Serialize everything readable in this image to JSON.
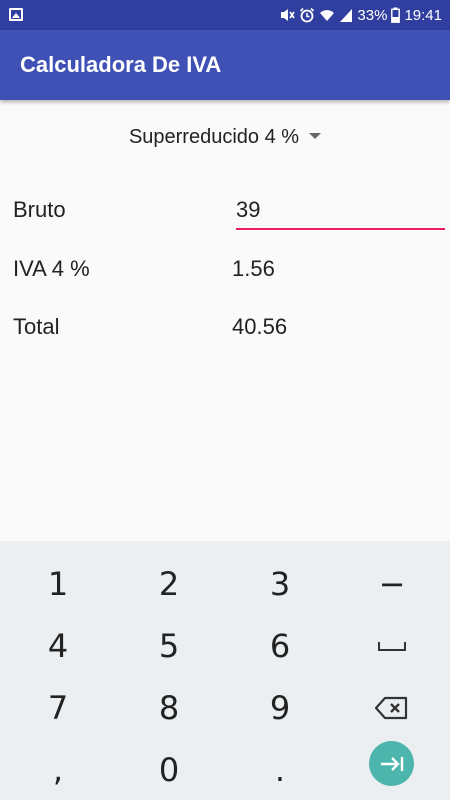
{
  "status_bar": {
    "battery_percent": "33%",
    "time": "19:41",
    "icons": [
      "gallery-icon",
      "mute-icon",
      "alarm-icon",
      "wifi-icon",
      "signal-icon",
      "battery-icon"
    ]
  },
  "app_bar": {
    "title": "Calculadora De IVA",
    "color": "#3f51b5",
    "status_color": "#303f9f"
  },
  "form": {
    "rate_selected": "Superreducido 4 %",
    "bruto_label": "Bruto",
    "bruto_value": "39",
    "iva_label": "IVA 4 %",
    "iva_value": "1.56",
    "total_label": "Total",
    "total_value": "40.56",
    "accent": "#e91e63"
  },
  "keyboard": {
    "keys": [
      "1",
      "2",
      "3",
      "−",
      "4",
      "5",
      "6",
      "␣",
      "7",
      "8",
      "9",
      "backspace",
      ",",
      "0",
      ".",
      "go"
    ],
    "go_color": "#4db6ac"
  }
}
